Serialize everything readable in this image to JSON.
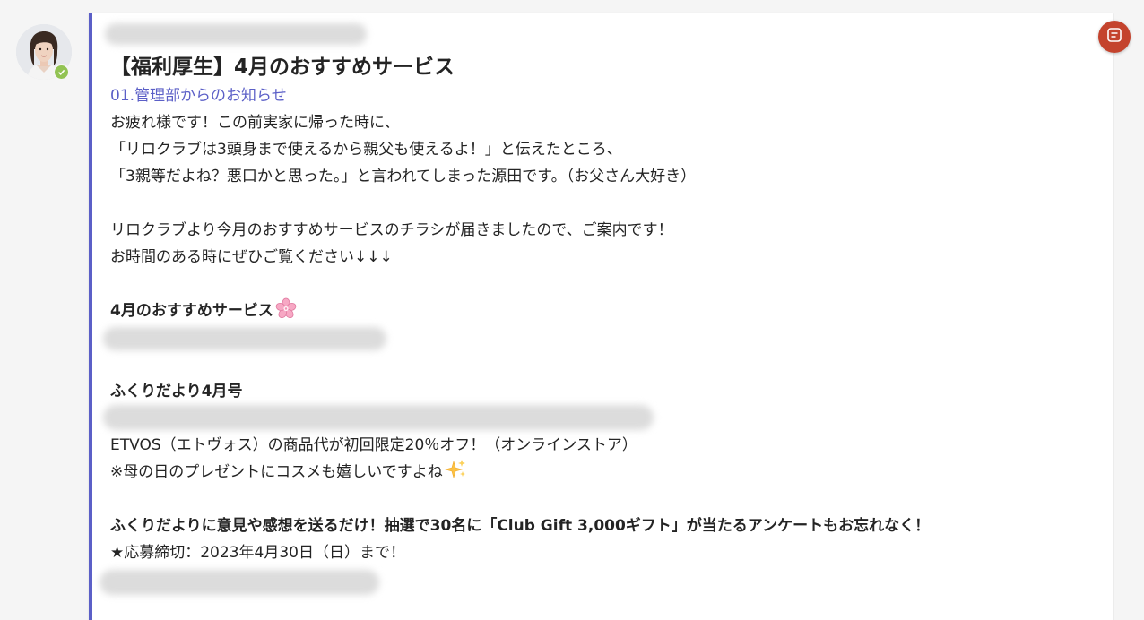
{
  "message": {
    "title": "【福利厚生】4月のおすすめサービス",
    "subtitle": "01.管理部からのお知らせ",
    "paragraph1": [
      "お疲れ様です！この前実家に帰った時に、",
      "「リロクラブは3頭身まで使えるから親父も使えるよ！」と伝えたところ、",
      "「3親等だよね？悪口かと思った。」と言われてしまった源田です。（お父さん大好き）"
    ],
    "paragraph2": [
      "リロクラブより今月のおすすめサービスのチラシが届きましたので、ご案内です！",
      "お時間のある時にぜひご覧ください↓↓↓"
    ],
    "section1_heading": "4月のおすすめサービス",
    "section2_heading": "ふくりだより4月号",
    "section2_lines": [
      "ETVOS（エトヴォス）の商品代が初回限定20％オフ！（オンラインストア）",
      "※母の日のプレゼントにコスメも嬉しいですよね"
    ],
    "survey_heading": "ふくりだよりに意見や感想を送るだけ！抽選で30名に「Club Gift 3,000ギフト」が当たるアンケートもお忘れなく！",
    "deadline": "★応募締切：2023年4月30日（日）まで！"
  },
  "icons": {
    "avatar": "profile-photo",
    "presence": "available-check-icon",
    "sakura": "cherry-blossom-emoji",
    "sparkles": "sparkles-emoji",
    "corner_button": "notes-icon"
  },
  "colors": {
    "accent": "#5b5fc7",
    "presence": "#92c353",
    "corner_button": "#c4432d"
  }
}
